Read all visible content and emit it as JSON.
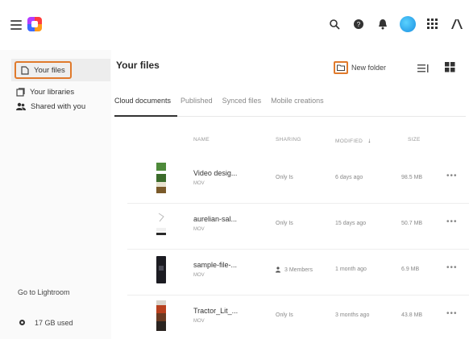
{
  "header": {
    "icons": [
      "menu-icon",
      "app-logo",
      "search-icon",
      "help-icon",
      "notifications-icon",
      "avatar",
      "apps-grid-icon",
      "adobe-icon"
    ]
  },
  "sidebar": {
    "items": [
      {
        "label": "Your files",
        "icon": "file-icon",
        "active": true
      },
      {
        "label": "Your libraries",
        "icon": "library-icon",
        "active": false
      },
      {
        "label": "Shared with you",
        "icon": "people-icon",
        "active": false
      }
    ],
    "goto_label": "Go to Lightroom",
    "storage_label": "17 GB used"
  },
  "main": {
    "title": "Your files",
    "new_folder_label": "New folder",
    "tabs": [
      {
        "label": "Cloud documents",
        "active": true
      },
      {
        "label": "Published",
        "active": false
      },
      {
        "label": "Synced files",
        "active": false
      },
      {
        "label": "Mobile creations",
        "active": false
      }
    ],
    "columns": {
      "name": "NAME",
      "sharing": "SHARING",
      "modified": "MODIFIED",
      "modified_sort": "↓",
      "size": "SIZE"
    },
    "files": [
      {
        "name": "Video desig...",
        "type": "MOV",
        "sharing": "Only Is",
        "modified": "6 days ago",
        "size": "98.5 MB",
        "more": "•••"
      },
      {
        "name": "aurelian-sal...",
        "type": "MOV",
        "sharing": "Only Is",
        "modified": "15 days ago",
        "size": "50.7 MB",
        "more": "•••"
      },
      {
        "name": "sample-file-...",
        "type": "MOV",
        "sharing": "3 Members",
        "modified": "1 month ago",
        "size": "6.9 MB",
        "more": "•••"
      },
      {
        "name": "Tractor_Lit_...",
        "type": "MOV",
        "sharing": "Only Is",
        "modified": "3 months ago",
        "size": "43.8 MB",
        "more": "•••"
      }
    ]
  },
  "colors": {
    "accent_outline": "#e07a2c",
    "avatar": "#1a8fe0"
  }
}
